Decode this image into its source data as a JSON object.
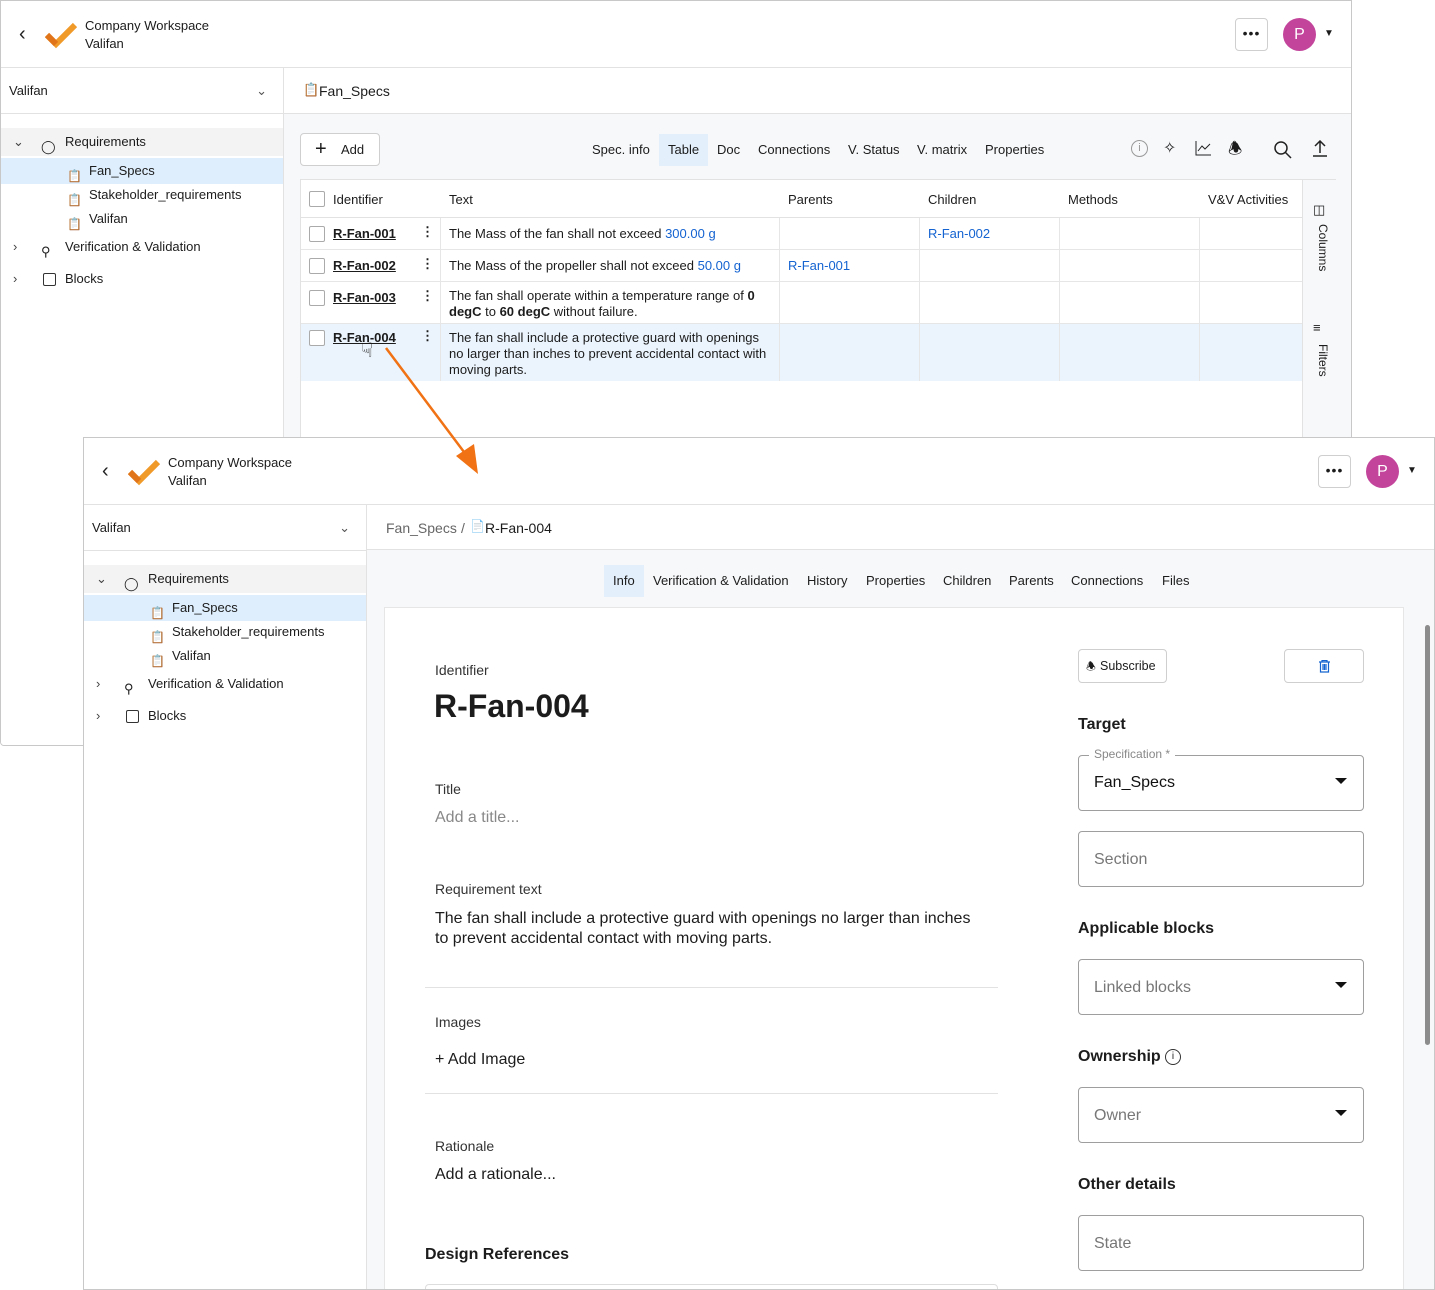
{
  "header": {
    "workspace": "Company Workspace",
    "project": "Valifan",
    "more_label": "•••",
    "avatar_initial": "P"
  },
  "sidebar": {
    "project_select": "Valifan",
    "items": [
      {
        "label": "Requirements"
      },
      {
        "label": "Fan_Specs"
      },
      {
        "label": "Stakeholder_requirements"
      },
      {
        "label": "Valifan"
      },
      {
        "label": "Verification & Validation"
      },
      {
        "label": "Blocks"
      }
    ]
  },
  "spec": {
    "title": "Fan_Specs",
    "add_label": "Add",
    "tabs": [
      "Spec. info",
      "Table",
      "Doc",
      "Connections",
      "V. Status",
      "V. matrix",
      "Properties"
    ],
    "active_tab": "Table",
    "side_panel": {
      "columns": "Columns",
      "filters": "Filters"
    },
    "table": {
      "headers": [
        "Identifier",
        "Text",
        "Parents",
        "Children",
        "Methods",
        "V&V Activities"
      ],
      "rows": [
        {
          "id": "R-Fan-001",
          "text": [
            "The Mass of the fan shall not exceed ",
            "300.00  g"
          ],
          "parents": "",
          "children": "R-Fan-002"
        },
        {
          "id": "R-Fan-002",
          "text": [
            "The Mass of the propeller shall not exceed ",
            "50.00  g"
          ],
          "parents": "R-Fan-001",
          "children": ""
        },
        {
          "id": "R-Fan-003",
          "text": [
            "The fan shall operate within a temperature range of ",
            "0",
            "degC",
            " to ",
            "60 degC",
            " without failure."
          ],
          "parents": "",
          "children": ""
        },
        {
          "id": "R-Fan-004",
          "text": [
            "The fan shall include a protective guard with openings no larger than inches to prevent accidental contact with moving parts."
          ],
          "parents": "",
          "children": ""
        }
      ]
    }
  },
  "detail": {
    "breadcrumb": {
      "parent": "Fan_Specs",
      "sep": "/",
      "current": "R-Fan-004"
    },
    "tabs": [
      "Info",
      "Verification & Validation",
      "History",
      "Properties",
      "Children",
      "Parents",
      "Connections",
      "Files"
    ],
    "active_tab": "Info",
    "identifier_label": "Identifier",
    "identifier": "R-Fan-004",
    "title_label": "Title",
    "title_placeholder": "Add a title...",
    "req_text_label": "Requirement text",
    "req_text": "The fan shall include a protective guard with openings no larger than inches to prevent accidental contact with moving parts.",
    "images_label": "Images",
    "add_image": "+ Add Image",
    "rationale_label": "Rationale",
    "rationale_placeholder": "Add a rationale...",
    "design_refs": "Design References",
    "subscribe": "Subscribe",
    "target": "Target",
    "spec_label": "Specification *",
    "spec_value": "Fan_Specs",
    "section_placeholder": "Section",
    "applicable_blocks": "Applicable blocks",
    "linked_blocks": "Linked blocks",
    "ownership": "Ownership",
    "owner": "Owner",
    "other_details": "Other details",
    "state": "State"
  },
  "colors": {
    "accent": "#1463d1",
    "avatar": "#c2449b",
    "arrow": "#f07214",
    "selected": "#deeefc"
  }
}
